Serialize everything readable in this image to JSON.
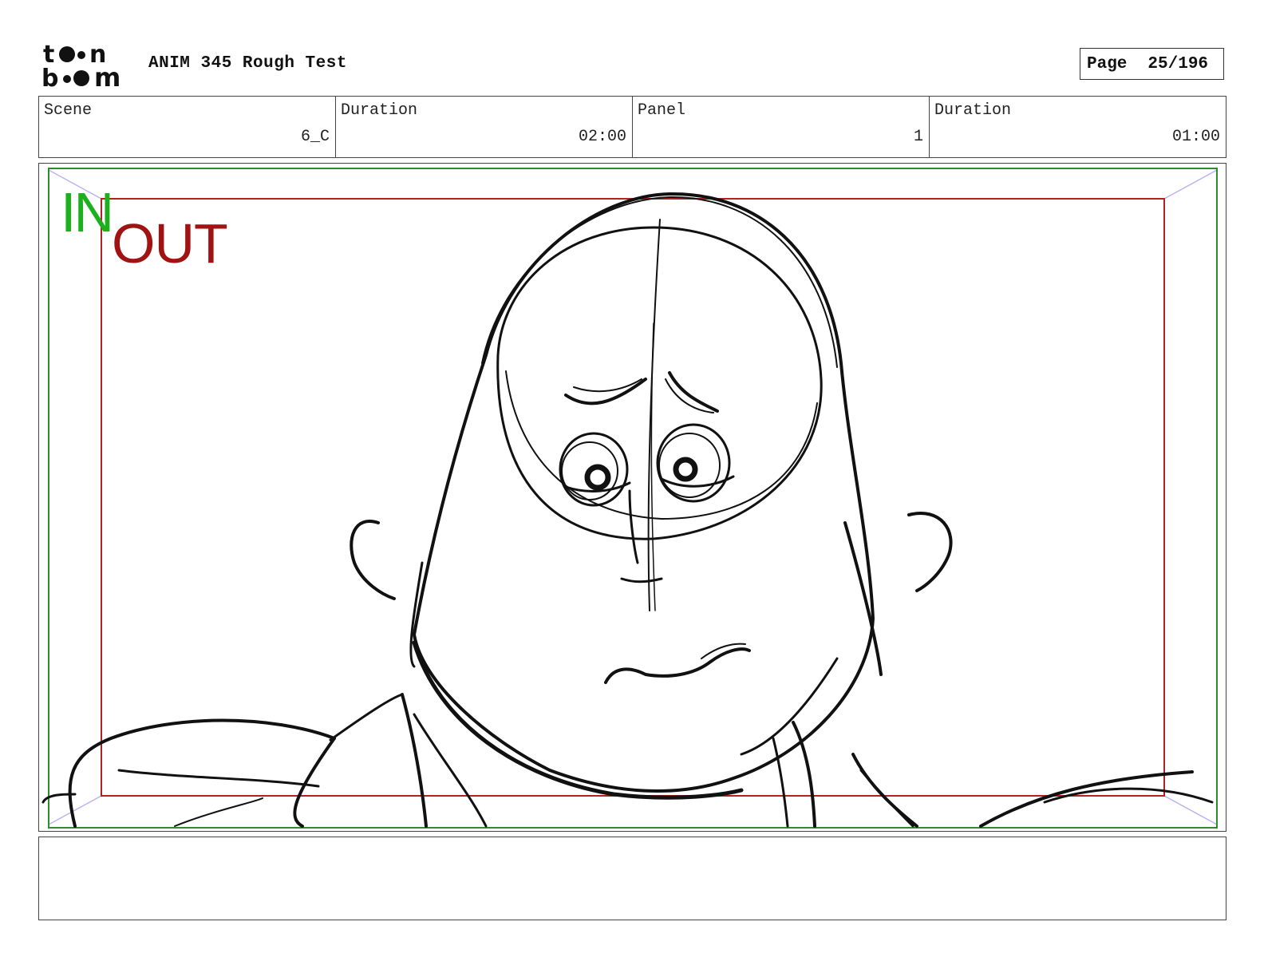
{
  "header": {
    "logo_text": "toon boom",
    "title": "ANIM 345 Rough Test",
    "page_label": "Page",
    "page_value": "25/196"
  },
  "info": [
    {
      "label": "Scene",
      "value": "6_C"
    },
    {
      "label": "Duration",
      "value": "02:00"
    },
    {
      "label": "Panel",
      "value": "1"
    },
    {
      "label": "Duration",
      "value": "01:00"
    }
  ],
  "frame": {
    "in_label": "IN",
    "out_label": "OUT",
    "in_color": "#1db01d",
    "out_color": "#a11212",
    "field_guide_color": "#b9b4f2"
  },
  "notes": {
    "text": ""
  }
}
